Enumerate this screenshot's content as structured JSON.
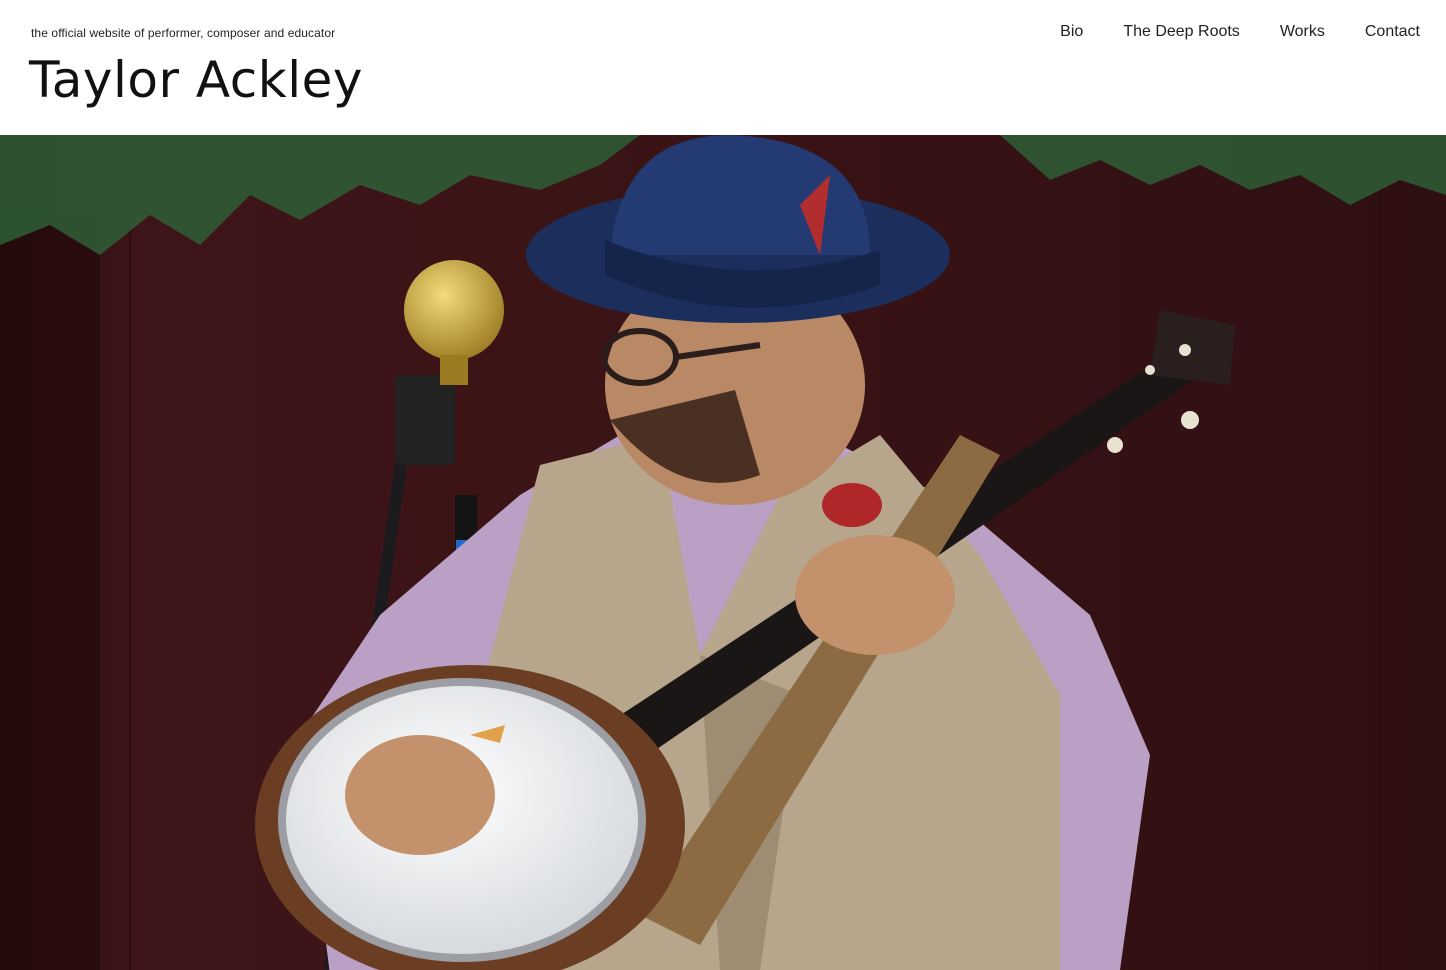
{
  "header": {
    "tagline": "the official website of performer, composer and educator",
    "title": "Taylor Ackley"
  },
  "nav": {
    "items": [
      {
        "label": "Bio"
      },
      {
        "label": "The Deep Roots"
      },
      {
        "label": "Works"
      },
      {
        "label": "Contact"
      }
    ]
  },
  "hero": {
    "image_icon": "banjo-performer-photo",
    "colors": {
      "backdrop": "#3a1416",
      "foliage": "#2f5a34",
      "hat": "#1c2f5c",
      "shirt": "#b9a0c4",
      "vest": "#b7a68c",
      "banjo_head": "#e6e6e6",
      "mic": "#c9a640"
    }
  }
}
